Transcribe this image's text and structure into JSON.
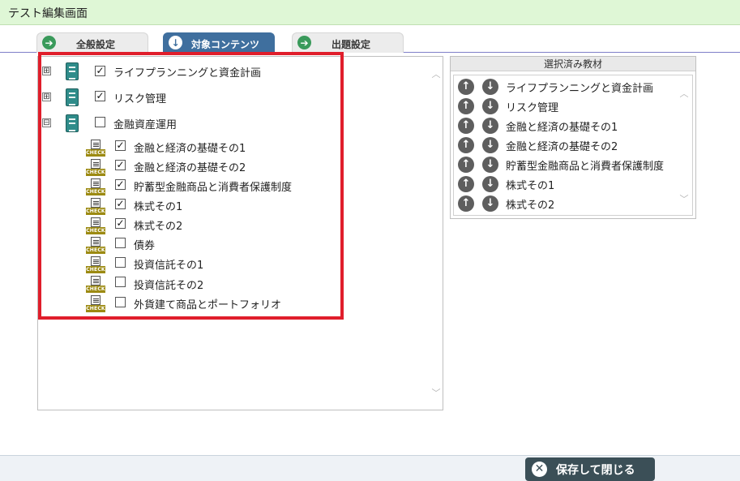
{
  "window": {
    "title": "テスト編集画面"
  },
  "tabs": [
    {
      "label": "全般設定",
      "icon": "arrow-right-icon",
      "active": false
    },
    {
      "label": "対象コンテンツ",
      "icon": "arrow-down-icon",
      "active": true
    },
    {
      "label": "出題設定",
      "icon": "arrow-right-icon",
      "active": false
    }
  ],
  "tree": {
    "parents": [
      {
        "label": "ライフプランニングと資金計画",
        "expander": "⊞",
        "checked": true,
        "check_mark": "✓"
      },
      {
        "label": "リスク管理",
        "expander": "⊞",
        "checked": true,
        "check_mark": "✓"
      },
      {
        "label": "金融資産運用",
        "expander": "⊟",
        "checked": false,
        "check_mark": ""
      }
    ],
    "children": [
      {
        "label": "金融と経済の基礎その1",
        "checked": true,
        "check_mark": "✓",
        "tag": "CHECK"
      },
      {
        "label": "金融と経済の基礎その2",
        "checked": true,
        "check_mark": "✓",
        "tag": "CHECK"
      },
      {
        "label": "貯蓄型金融商品と消費者保護制度",
        "checked": true,
        "check_mark": "✓",
        "tag": "CHECK"
      },
      {
        "label": "株式その1",
        "checked": true,
        "check_mark": "✓",
        "tag": "CHECK"
      },
      {
        "label": "株式その2",
        "checked": true,
        "check_mark": "✓",
        "tag": "CHECK"
      },
      {
        "label": "債券",
        "checked": false,
        "check_mark": "",
        "tag": "CHECK"
      },
      {
        "label": "投資信託その1",
        "checked": false,
        "check_mark": "",
        "tag": "CHECK"
      },
      {
        "label": "投資信託その2",
        "checked": false,
        "check_mark": "",
        "tag": "CHECK"
      },
      {
        "label": "外貨建て商品とポートフォリオ",
        "checked": false,
        "check_mark": "",
        "tag": "CHECK"
      }
    ]
  },
  "selected": {
    "header": "選択済み教材",
    "items": [
      "ライフプランニングと資金計画",
      "リスク管理",
      "金融と経済の基礎その1",
      "金融と経済の基礎その2",
      "貯蓄型金融商品と消費者保護制度",
      "株式その1",
      "株式その2"
    ]
  },
  "footer": {
    "save_label": "保存して閉じる"
  },
  "colors": {
    "highlight_border": "#e01e2b",
    "active_tab": "#3f6f9e",
    "title_bar": "#dff7d6"
  }
}
